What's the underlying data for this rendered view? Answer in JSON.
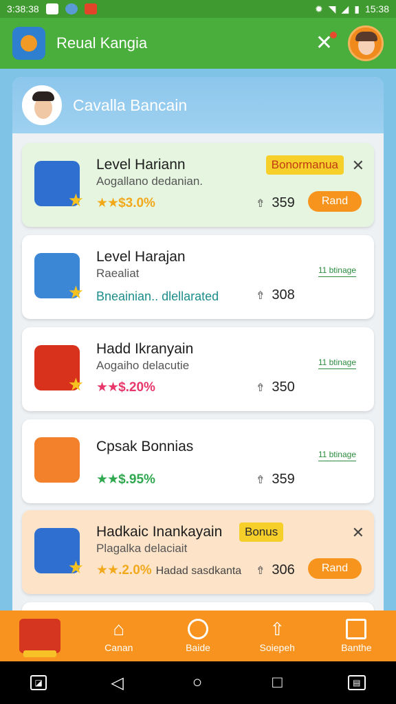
{
  "status_bar": {
    "time_left": "3:38:38",
    "time_right": "15:38"
  },
  "app_bar": {
    "title": "Reual Kangia",
    "close_icon": "close-icon",
    "avatar_icon": "avatar"
  },
  "panel": {
    "title": "Cavalla Bancain"
  },
  "cards": [
    {
      "title": "Level Hariann",
      "subtitle": "Aogallano dedanian.",
      "rating_value": "$3.0%",
      "stars": "★★",
      "star_color": "#f2a91c",
      "badge": "Bonormanua",
      "count": "359",
      "button": "Rand",
      "style": "green",
      "icon_color": "#2f6fd0"
    },
    {
      "title": "Level Harajan",
      "subtitle": "Raealiat",
      "extra": "Bneainian.. dlellarated",
      "count": "308",
      "link": "11 btinage",
      "style": "white",
      "icon_color": "#3c86d6"
    },
    {
      "title": "Hadd Ikranyain",
      "subtitle": "Aogaiho delacutie",
      "rating_value": "$.20%",
      "stars": "★★",
      "star_color": "#e8386b",
      "count": "350",
      "link": "11 btinage",
      "style": "white",
      "icon_color": "#d8321d"
    },
    {
      "title": "Cpsak Bonnias",
      "rating_value": "$.95%",
      "stars": "★★",
      "star_color": "#2fa84f",
      "count": "359",
      "link": "11 btinage",
      "style": "white",
      "icon_color": "#f3802b"
    },
    {
      "title": "Hadkaic Inankayain",
      "subtitle": "Plagalka delaciait",
      "rating_value": ".2.0%",
      "stars": "★★",
      "star_color": "#f2a91c",
      "rating_note": "Hadad sasdkanta",
      "badge": "Bonus",
      "count": "306",
      "button": "Rand",
      "style": "peach",
      "icon_color": "#2f6fd0"
    }
  ],
  "bottom_nav": [
    {
      "label": "",
      "icon": "home-icon"
    },
    {
      "label": "Canan",
      "icon": "house-icon"
    },
    {
      "label": "Baide",
      "icon": "bell-icon"
    },
    {
      "label": "Soiepeh",
      "icon": "upload-icon"
    },
    {
      "label": "Banthe",
      "icon": "frame-icon"
    }
  ]
}
